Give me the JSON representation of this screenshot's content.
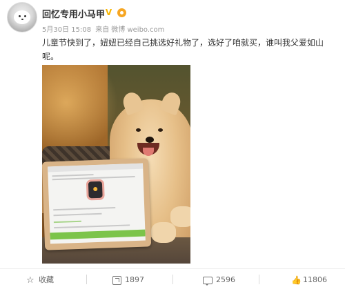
{
  "post": {
    "username": "回忆专用小马甲",
    "vip_badge": "V",
    "date": "5月30日 15:08",
    "source_prefix": "来自",
    "source": "微博 weibo.com",
    "text": "儿童节快到了，妞妞已经自己挑选好礼物了，选好了咱就买，谁叫我父爱如山呢。"
  },
  "actions": {
    "collect_label": "收藏",
    "forward_count": "1897",
    "comment_count": "2596",
    "like_count": "11806"
  },
  "colors": {
    "username": "#333333",
    "meta": "#999999",
    "vip_badge": "#f7b500",
    "action_text": "#666666"
  },
  "icons": {
    "collect": "star-icon",
    "forward": "forward-icon",
    "comment": "comment-icon",
    "like": "thumbs-up-icon"
  }
}
